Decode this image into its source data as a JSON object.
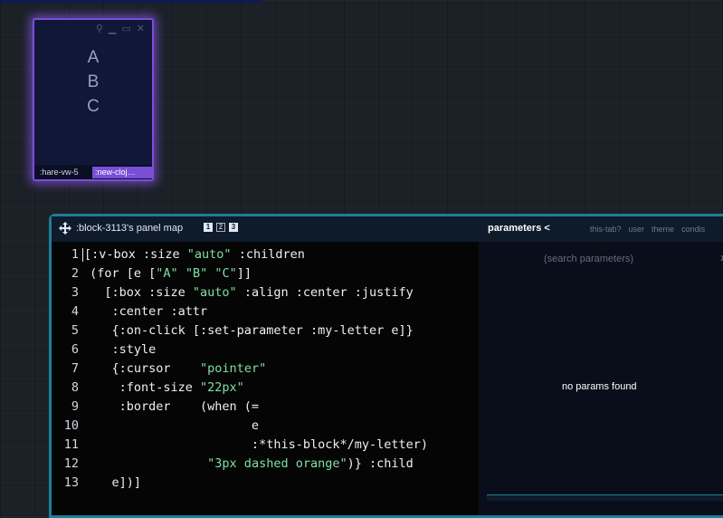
{
  "mini_window": {
    "controls": [
      "pin-icon",
      "minimize-icon",
      "restore-icon",
      "close-icon"
    ],
    "control_glyphs": [
      "⚲",
      "▁",
      "▭",
      "✕"
    ],
    "letters": [
      "A",
      "B",
      "C"
    ],
    "footer": {
      "tab1": ":hare-vw-5",
      "tab2": ":new-cloj…"
    },
    "accent_color": "#7a4fd6"
  },
  "panel": {
    "title": ":block-3113's panel map",
    "view_buttons": [
      "1",
      "2",
      "3"
    ],
    "active_view_buttons": [
      "1",
      "3"
    ],
    "params_title": "parameters <",
    "tabs": [
      "this-tab?",
      "user",
      "theme",
      "condis"
    ],
    "border_color": "#1c7f98"
  },
  "editor": {
    "line_numbers": [
      "1",
      "2",
      "3",
      "4",
      "5",
      "6",
      "7",
      "8",
      "9",
      "10",
      "11",
      "12",
      "13"
    ],
    "lines": [
      "[:v-box :size \"auto\" :children",
      " (for [e [\"A\" \"B\" \"C\"]]",
      "   [:box :size \"auto\" :align :center :justify",
      "    :center :attr",
      "    {:on-click [:set-parameter :my-letter e]}",
      "    :style",
      "    {:cursor    \"pointer\"",
      "     :font-size \"22px\"",
      "     :border    (when (=",
      "                       e",
      "                       :*this-block*/my-letter)",
      "                 \"3px dashed orange\")} :child",
      "    e])]"
    ]
  },
  "params": {
    "search_placeholder": "(search parameters)",
    "clear": "x",
    "empty_message": "no params found"
  }
}
